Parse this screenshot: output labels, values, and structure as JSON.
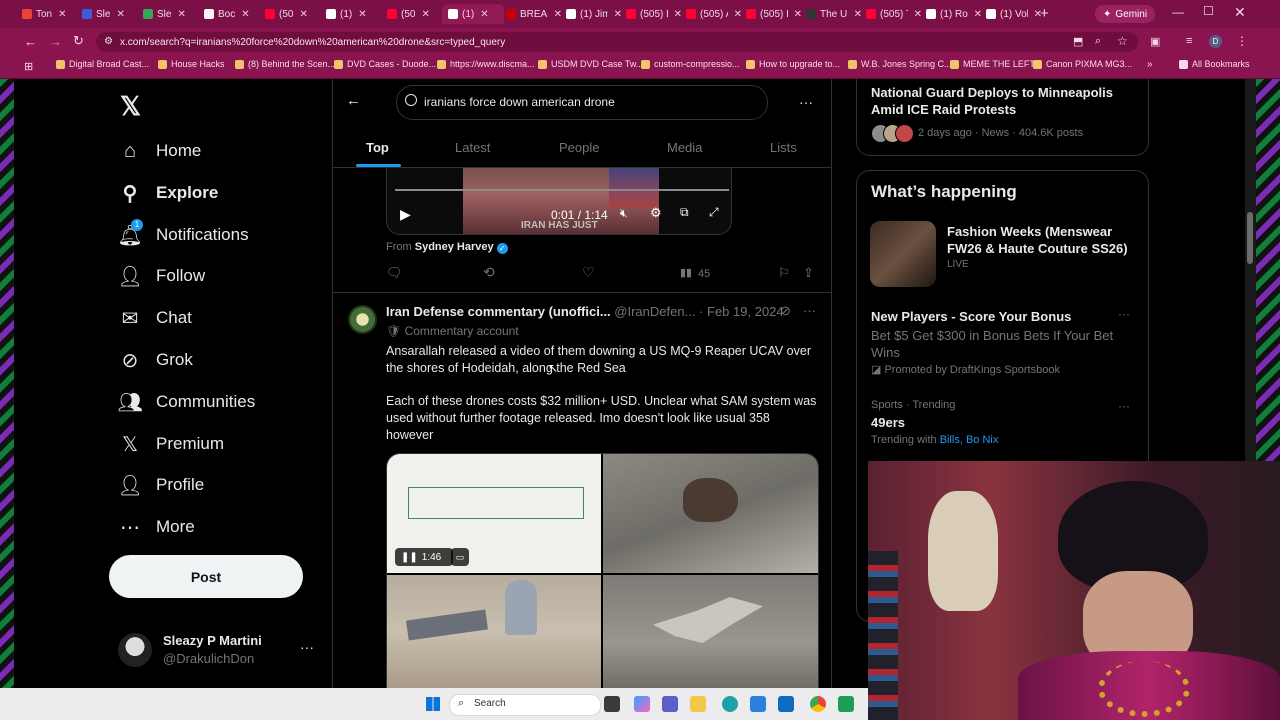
{
  "browser": {
    "tabs": [
      {
        "label": "Ton",
        "color": "#ea4335"
      },
      {
        "label": "Sle",
        "color": "#3b5bdb"
      },
      {
        "label": "Sle",
        "color": "#34a853"
      },
      {
        "label": "Boc",
        "color": "#f6f6f6"
      },
      {
        "label": "(50",
        "color": "#ff0033"
      },
      {
        "label": "(1)",
        "color": "#ffffff"
      },
      {
        "label": "(50",
        "color": "#ff0033"
      },
      {
        "label": "(1)",
        "color": "#ffffff"
      },
      {
        "label": "BREAKI",
        "color": "#c00"
      },
      {
        "label": "(1) Jim",
        "color": "#ffffff"
      },
      {
        "label": "(505) Bi",
        "color": "#ff0033"
      },
      {
        "label": "(505) A",
        "color": "#ff0033"
      },
      {
        "label": "(505) In",
        "color": "#ff0033"
      },
      {
        "label": "The UK",
        "color": "#333"
      },
      {
        "label": "(505) Tl",
        "color": "#ff0033"
      },
      {
        "label": "(1) Rob",
        "color": "#ffffff"
      },
      {
        "label": "(1) Volc",
        "color": "#ffffff"
      }
    ],
    "gemini_label": "Gemini",
    "url": "x.com/search?q=iranians%20force%20down%20american%20drone&src=typed_query",
    "bookmarks": [
      "Digital Broad Cast...",
      "House Hacks",
      "(8) Behind the Scen...",
      "DVD Cases - Duode...",
      "https://www.discma...",
      "USDM DVD Case Tw...",
      "custom-compressio...",
      "How to upgrade to...",
      "W.B. Jones Spring C...",
      "MEME THE LEFT",
      "Canon PIXMA MG3..."
    ],
    "all_bookmarks": "All Bookmarks"
  },
  "sidebar": {
    "items": [
      {
        "label": "Home",
        "icon": "home-icon"
      },
      {
        "label": "Explore",
        "icon": "search-icon"
      },
      {
        "label": "Notifications",
        "icon": "bell-icon",
        "badge": "1"
      },
      {
        "label": "Follow",
        "icon": "follow-icon"
      },
      {
        "label": "Chat",
        "icon": "mail-icon"
      },
      {
        "label": "Grok",
        "icon": "grok-icon"
      },
      {
        "label": "Communities",
        "icon": "communities-icon"
      },
      {
        "label": "Premium",
        "icon": "x-icon"
      },
      {
        "label": "Profile",
        "icon": "person-icon"
      },
      {
        "label": "More",
        "icon": "more-icon"
      }
    ],
    "post_label": "Post",
    "user": {
      "name": "Sleazy P Martini",
      "handle": "@DrakulichDon"
    }
  },
  "search": {
    "query": "iranians force down american drone",
    "tabs": [
      "Top",
      "Latest",
      "People",
      "Media",
      "Lists"
    ]
  },
  "video": {
    "time": "0:01 / 1:14",
    "overlay": "IRAN HAS JUST"
  },
  "from": {
    "prefix": "From",
    "name": "Sydney Harvey"
  },
  "actions1": {
    "views": "45"
  },
  "tweet": {
    "name": "Iran Defense commentary (unoffici...",
    "handle": "@IranDefen...",
    "date": "Feb 19, 2024",
    "badge": "Commentary account",
    "text1": "Ansarallah released a video of them downing a US MQ-9 Reaper UCAV over the shores of Hodeidah, along the Red Sea",
    "text2": "Each of these drones costs $32 million+ USD. Unclear what SAM system was used without further footage released. Imo doesn't look like usual 358 however",
    "video_time": "1:46"
  },
  "trending_top": {
    "title": "National Guard Deploys to Minneapolis Amid ICE Raid Protests",
    "meta": "2 days ago · News · 404.6K posts"
  },
  "happening": {
    "heading": "What’s happening",
    "event_title": "Fashion Weeks (Menswear FW26 & Haute Couture SS26)",
    "event_status": "LIVE",
    "promo_title": "New Players - Score Your Bonus",
    "promo_text": "Bet $5 Get $300 in Bonus Bets If Your Bet Wins",
    "promo_by": "Promoted by DraftKings Sportsbook",
    "trend_cat": "Sports · Trending",
    "trend_name": "49ers",
    "trend_with_prefix": "Trending with",
    "trend_with": "Bills, Bo Nix"
  },
  "taskbar": {
    "search_label": "Search"
  }
}
